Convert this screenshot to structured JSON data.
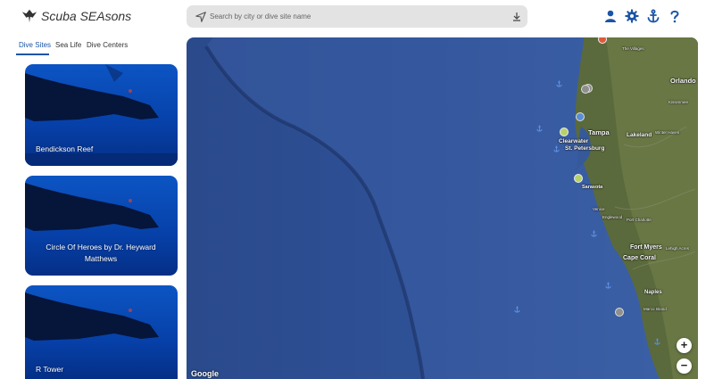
{
  "app": {
    "title": "Scuba SEAsons"
  },
  "search": {
    "placeholder": "Search by city or dive site name"
  },
  "header_icons": [
    "user-icon",
    "gear-icon",
    "anchor-icon",
    "help-icon"
  ],
  "tabs": [
    {
      "label": "Dive Sites",
      "active": true
    },
    {
      "label": "Sea Life",
      "active": false
    },
    {
      "label": "Dive Centers",
      "active": false
    }
  ],
  "cards": [
    {
      "label": "Bendickson Reef"
    },
    {
      "label": "Circle Of Heroes by Dr. Heyward Matthews"
    },
    {
      "label": "R Tower"
    }
  ],
  "map": {
    "cities": [
      "Tampa",
      "Clearwater",
      "St. Petersburg",
      "Lakeland",
      "Orlando",
      "Fort Myers",
      "Cape Coral",
      "Sarasota",
      "Naples"
    ],
    "small_labels": [
      "The Villages",
      "Kissimmee",
      "Englewood",
      "Port Charlotte",
      "Venice",
      "Marco Island",
      "Winter Haven",
      "Lehigh Acres"
    ],
    "attribution": "Google",
    "zoom_in": "+",
    "zoom_out": "−"
  },
  "colors": {
    "accent": "#1b55a6",
    "ocean": "#2b4d8e",
    "card_water": "#0a47b0"
  }
}
